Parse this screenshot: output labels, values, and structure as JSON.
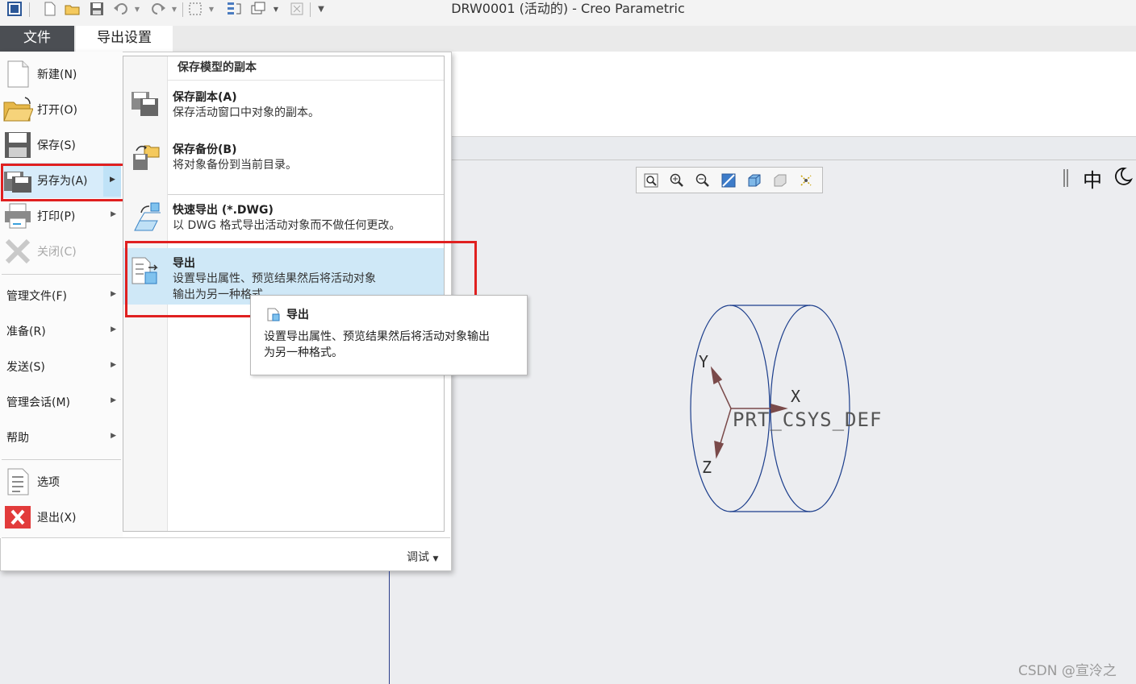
{
  "window": {
    "title": "DRW0001 (活动的) - Creo Parametric"
  },
  "ribbon": {
    "tabs": [
      {
        "label": "文件"
      },
      {
        "label": "导出设置"
      }
    ]
  },
  "file_menu": {
    "items": [
      {
        "label": "新建(N)",
        "icon": "new-file-icon"
      },
      {
        "label": "打开(O)",
        "icon": "open-folder-icon"
      },
      {
        "label": "保存(S)",
        "icon": "save-icon"
      },
      {
        "label": "另存为(A)",
        "icon": "save-as-icon",
        "has_submenu": true
      },
      {
        "label": "打印(P)",
        "icon": "print-icon",
        "has_submenu": true
      },
      {
        "label": "关闭(C)",
        "icon": "close-icon",
        "disabled": true
      }
    ],
    "items2": [
      {
        "label": "管理文件(F)"
      },
      {
        "label": "准备(R)"
      },
      {
        "label": "发送(S)"
      },
      {
        "label": "管理会话(M)"
      },
      {
        "label": "帮助"
      }
    ],
    "items3": [
      {
        "label": "选项",
        "icon": "options-icon"
      },
      {
        "label": "退出(X)",
        "icon": "exit-icon"
      }
    ],
    "debug_label": "调试"
  },
  "submenu": {
    "header": "保存模型的副本",
    "items": [
      {
        "title": "保存副本(A)",
        "desc": "保存活动窗口中对象的副本。"
      },
      {
        "title": "保存备份(B)",
        "desc": "将对象备份到当前目录。"
      },
      {
        "title": "快速导出 (*.DWG)",
        "desc": "以 DWG 格式导出活动对象而不做任何更改。"
      },
      {
        "title": "导出",
        "desc1": "设置导出属性、预览结果然后将活动对象",
        "desc2": "输出为另一种格式。"
      }
    ]
  },
  "tooltip": {
    "title": "导出",
    "desc1": "设置导出属性、预览结果然后将活动对象输出",
    "desc2": "为另一种格式。"
  },
  "drawing": {
    "csys_label": "PRT_CSYS_DEF",
    "axis_x": "X",
    "axis_y": "Y",
    "axis_z": "Z"
  },
  "view_controls": {
    "label": "中"
  },
  "watermark": "CSDN @宣泠之",
  "colors": {
    "highlight_red": "#e02020",
    "selection_blue": "#cfe8f7",
    "file_tab": "#4b4e53"
  }
}
